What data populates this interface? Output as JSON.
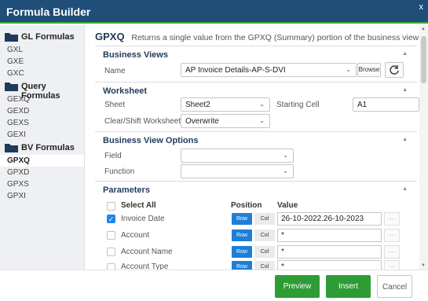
{
  "window": {
    "title": "Formula Builder",
    "close": "x"
  },
  "sidebar": {
    "groups": [
      {
        "label": "GL Formulas",
        "items": [
          "GXL",
          "GXE",
          "GXC"
        ]
      },
      {
        "label": "Query Formulas",
        "items": [
          "GEXQ",
          "GEXD",
          "GEXS",
          "GEXI"
        ]
      },
      {
        "label": "BV Formulas",
        "items": [
          "GPXQ",
          "GPXD",
          "GPXS",
          "GPXI"
        ]
      }
    ],
    "active": "GPXQ"
  },
  "formula": {
    "name": "GPXQ",
    "description": "Returns a single value from the GPXQ (Summary) portion of the business view"
  },
  "business_views": {
    "title": "Business Views",
    "name_label": "Name",
    "name_value": "AP Invoice Details-AP-S-DVI",
    "browse_label": "Browse"
  },
  "worksheet": {
    "title": "Worksheet",
    "sheet_label": "Sheet",
    "sheet_value": "Sheet2",
    "starting_cell_label": "Starting Cell",
    "starting_cell_value": "A1",
    "clear_label": "Clear/Shift Worksheet",
    "clear_value": "Overwrite"
  },
  "bv_options": {
    "title": "Business View Options",
    "field_label": "Field",
    "field_value": "",
    "function_label": "Function",
    "function_value": ""
  },
  "parameters": {
    "title": "Parameters",
    "col_position": "Position",
    "col_value": "Value",
    "select_all": "Select All",
    "row_btn": "Row",
    "col_btn": "Col",
    "more_btn": "...",
    "rows": [
      {
        "label": "Invoice Date",
        "checked": true,
        "value": "26-10-2022.26-10-2023"
      },
      {
        "label": "Account",
        "checked": false,
        "value": "*"
      },
      {
        "label": "Account Name",
        "checked": false,
        "value": "*"
      },
      {
        "label": "Account Type",
        "checked": false,
        "value": "*"
      }
    ]
  },
  "footer": {
    "preview": "Preview",
    "insert": "Insert",
    "cancel": "Cancel"
  }
}
